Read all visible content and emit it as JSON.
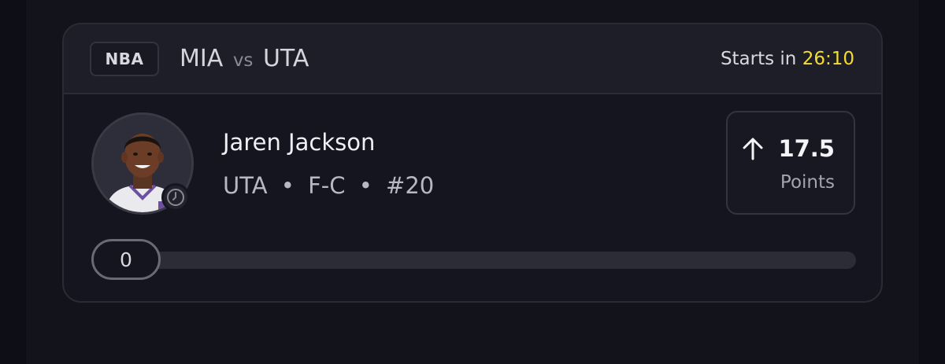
{
  "card": {
    "league": "NBA",
    "team_away": "MIA",
    "vs_label": "vs",
    "team_home": "UTA",
    "starts_label": "Starts in",
    "starts_timer": "26:10",
    "timer_color": "#f4dd2f"
  },
  "player": {
    "name": "Jaren Jackson",
    "team": "UTA",
    "position": "F-C",
    "number": "#20",
    "separator": "•"
  },
  "line": {
    "direction_icon": "arrow-up-icon",
    "value": "17.5",
    "stat": "Points"
  },
  "progress": {
    "current": "0",
    "fraction": 0
  }
}
